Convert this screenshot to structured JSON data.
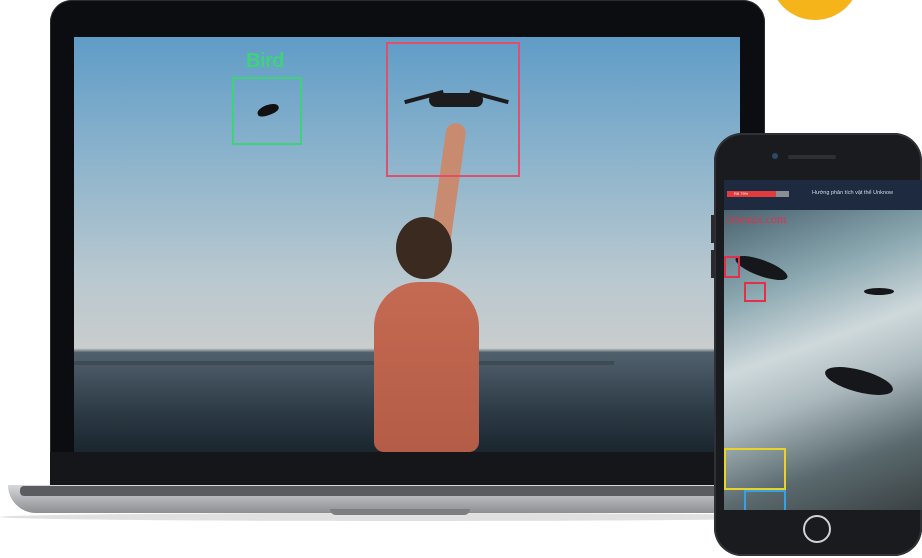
{
  "laptop": {
    "detections": [
      {
        "label": "Bird",
        "color": "#3fd27b"
      },
      {
        "label": "",
        "color": "#e0506a"
      }
    ]
  },
  "phone": {
    "progress": {
      "text": "R8 79%",
      "percent": 79,
      "color": "#e23b3b"
    },
    "title": "Hướng phân tích vật thể Unknow",
    "watermark": "oiseaux.com",
    "detections": [
      {
        "color": "#e0304a"
      },
      {
        "color": "#e0304a"
      },
      {
        "color": "#e6d42a"
      },
      {
        "color": "#3aa0e0"
      }
    ]
  },
  "colors": {
    "accent_orange": "#f4b41a",
    "phone_topbar": "#1d2a3f"
  }
}
